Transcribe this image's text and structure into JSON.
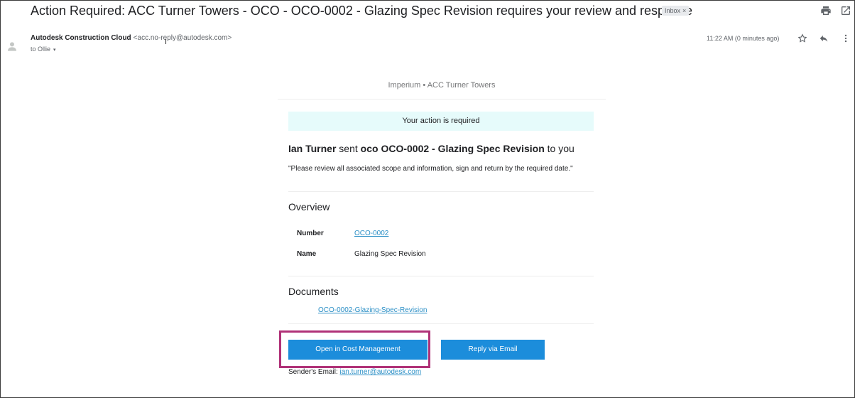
{
  "email": {
    "subject": "Action Required: ACC Turner Towers - OCO - OCO-0002 - Glazing Spec Revision requires your review and response",
    "label": "Inbox",
    "label_remove": "×",
    "sender_name": "Autodesk Construction Cloud",
    "sender_address": "<acc.no-reply@autodesk.com>",
    "to_line": "to Ollie",
    "to_caret": "▾",
    "time": "11:22 AM (0 minutes ago)"
  },
  "body": {
    "org": "Imperium • ACC Turner Towers",
    "notice": "Your action is required",
    "headline": {
      "actor": "Ian Turner",
      "verb": " sent ",
      "item": "oco OCO-0002 - Glazing Spec Revision",
      "suffix": " to you"
    },
    "quote": "\"Please review all associated scope and information, sign and return by the required date.\"",
    "overview": {
      "heading": "Overview",
      "number_label": "Number",
      "number_value": "OCO-0002",
      "name_label": "Name",
      "name_value": "Glazing Spec Revision"
    },
    "documents": {
      "heading": "Documents",
      "file": "OCO-0002-Glazing-Spec-Revision"
    },
    "buttons": {
      "open": "Open in Cost Management",
      "reply": "Reply via Email"
    },
    "sender_email_label": "Sender's Email: ",
    "sender_email": "ian.turner@autodesk.com"
  },
  "icons": [
    "print-icon",
    "open-in-new-window-icon",
    "avatar-icon",
    "star-icon",
    "reply-icon",
    "more-options-icon",
    "text-cursor-icon"
  ],
  "colors": {
    "link": "#2b8fc6",
    "button": "#1c8ddb",
    "notice_bg": "#e6fbfb",
    "highlight": "#b03278"
  }
}
